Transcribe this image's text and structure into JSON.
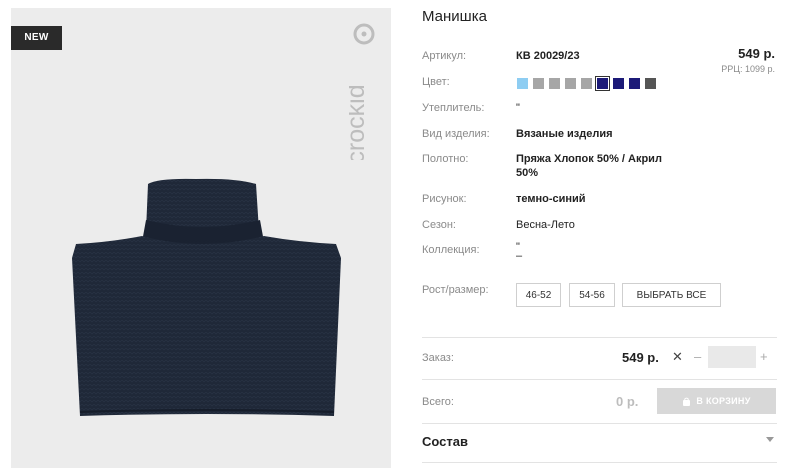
{
  "product": {
    "badge": "NEW",
    "brand": "crockid",
    "title": "Манишка",
    "price": "549 р.",
    "rrp": "РРЦ: 1099 р.",
    "specs": {
      "article": {
        "label": "Артикул:",
        "value": "КВ 20029/23"
      },
      "color": {
        "label": "Цвет:"
      },
      "insulation": {
        "label": "Утеплитель:",
        "value": "\""
      },
      "item_type": {
        "label": "Вид изделия:",
        "value": "Вязаные изделия"
      },
      "fabric": {
        "label": "Полотно:",
        "value_line1": "Пряжа Хлопок 50% / Акрил",
        "value_line2": "50%"
      },
      "pattern": {
        "label": "Рисунок:",
        "value": "темно-синий"
      },
      "season": {
        "label": "Сезон:",
        "value": "Весна-Лето"
      },
      "collection": {
        "label": "Коллекция:",
        "value_line1": "\"",
        "value_line2": "–"
      }
    },
    "swatch_colors": [
      "#8ecdf2",
      "#a6a6a6",
      "#a6a6a6",
      "#a6a6a6",
      "#a6a6a6",
      "#1c1a78",
      "#1c1a78",
      "#1c1a78",
      "#555555"
    ],
    "selected_swatch_index": 5
  },
  "sizes": {
    "label": "Рост/размер:",
    "options": [
      "46-52",
      "54-56"
    ],
    "select_all": "ВЫБРАТЬ ВСЕ"
  },
  "order": {
    "label": "Заказ:",
    "price": "549 р.",
    "times": "✕",
    "minus": "–",
    "plus": "+",
    "quantity": ""
  },
  "total": {
    "label": "Всего:",
    "value": "0 р.",
    "cart_button": "В КОРЗИНУ"
  },
  "composition": {
    "label": "Состав"
  },
  "colors": {
    "badge_bg": "#2a2a2a",
    "photo_bg": "#ececec",
    "button_disabled": "#d8d8d8",
    "garment": "#1f2838"
  }
}
